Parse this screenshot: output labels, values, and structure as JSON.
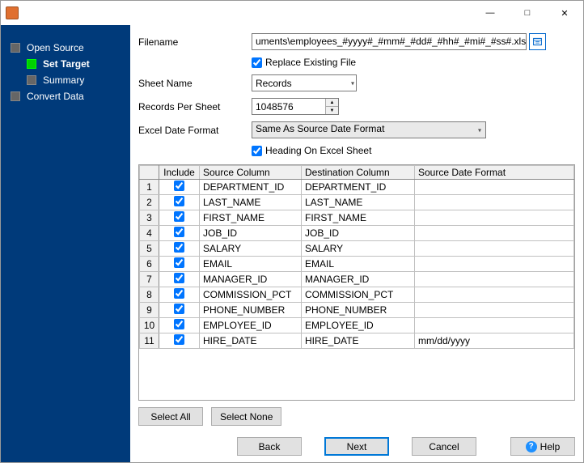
{
  "nav": {
    "open_source": "Open Source",
    "set_target": "Set Target",
    "summary": "Summary",
    "convert_data": "Convert Data"
  },
  "form": {
    "filename_label": "Filename",
    "filename_value": "uments\\employees_#yyyy#_#mm#_#dd#_#hh#_#mi#_#ss#.xlsx",
    "replace_label": "Replace Existing File",
    "sheet_label": "Sheet Name",
    "sheet_value": "Records",
    "records_label": "Records Per Sheet",
    "records_value": "1048576",
    "dateformat_label": "Excel Date Format",
    "dateformat_value": "Same As Source Date Format",
    "heading_label": "Heading On Excel Sheet"
  },
  "table": {
    "headers": {
      "include": "Include",
      "source": "Source Column",
      "dest": "Destination Column",
      "dateformat": "Source Date Format"
    },
    "rows": [
      {
        "n": "1",
        "src": "DEPARTMENT_ID",
        "dst": "DEPARTMENT_ID",
        "fmt": ""
      },
      {
        "n": "2",
        "src": "LAST_NAME",
        "dst": "LAST_NAME",
        "fmt": ""
      },
      {
        "n": "3",
        "src": "FIRST_NAME",
        "dst": "FIRST_NAME",
        "fmt": ""
      },
      {
        "n": "4",
        "src": "JOB_ID",
        "dst": "JOB_ID",
        "fmt": ""
      },
      {
        "n": "5",
        "src": "SALARY",
        "dst": "SALARY",
        "fmt": ""
      },
      {
        "n": "6",
        "src": "EMAIL",
        "dst": "EMAIL",
        "fmt": ""
      },
      {
        "n": "7",
        "src": "MANAGER_ID",
        "dst": "MANAGER_ID",
        "fmt": ""
      },
      {
        "n": "8",
        "src": "COMMISSION_PCT",
        "dst": "COMMISSION_PCT",
        "fmt": ""
      },
      {
        "n": "9",
        "src": "PHONE_NUMBER",
        "dst": "PHONE_NUMBER",
        "fmt": ""
      },
      {
        "n": "10",
        "src": "EMPLOYEE_ID",
        "dst": "EMPLOYEE_ID",
        "fmt": ""
      },
      {
        "n": "11",
        "src": "HIRE_DATE",
        "dst": "HIRE_DATE",
        "fmt": "mm/dd/yyyy"
      }
    ]
  },
  "buttons": {
    "select_all": "Select All",
    "select_none": "Select None",
    "back": "Back",
    "next": "Next",
    "cancel": "Cancel",
    "help": "Help"
  }
}
